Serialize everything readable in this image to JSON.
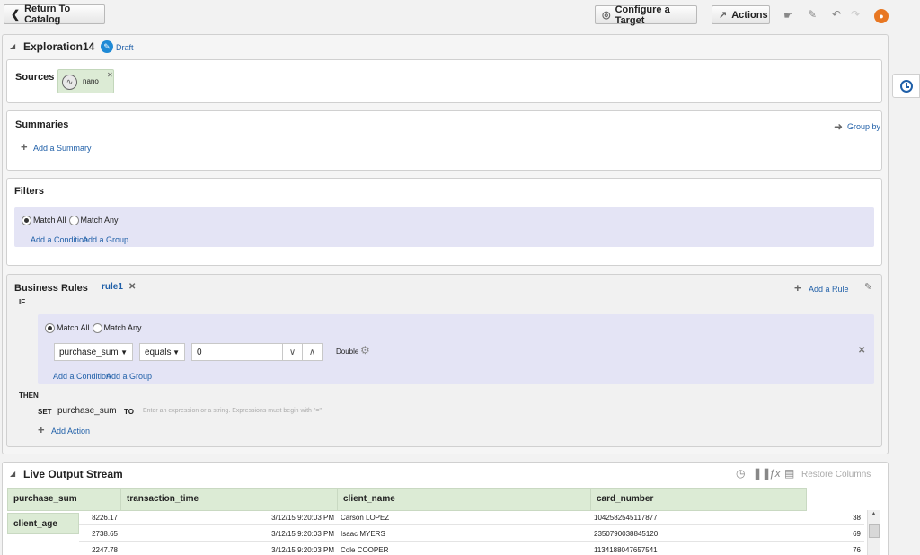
{
  "toolbar": {
    "return_label": "Return To Catalog",
    "configure_label": "Configure a Target",
    "actions_label": "Actions"
  },
  "exploration": {
    "title": "Exploration14",
    "status": "Draft"
  },
  "sources": {
    "label": "Sources",
    "items": [
      {
        "name": "nano"
      }
    ]
  },
  "summaries": {
    "label": "Summaries",
    "group_by_label": "Group by",
    "add_summary_label": "Add a Summary"
  },
  "filters": {
    "label": "Filters",
    "match_all": "Match All",
    "match_any": "Match Any",
    "add_condition": "Add a Condition",
    "add_group": "Add a Group"
  },
  "business_rules": {
    "label": "Business Rules",
    "rule_name": "rule1",
    "add_rule_label": "Add a Rule",
    "if_label": "IF",
    "then_label": "THEN",
    "match_all": "Match All",
    "match_any": "Match Any",
    "condition": {
      "field": "purchase_sum",
      "operator": "equals",
      "value": "0",
      "type": "Double"
    },
    "add_condition": "Add a Condition",
    "add_group": "Add a Group",
    "set_label": "SET",
    "set_field": "purchase_sum",
    "to_label": "TO",
    "expression_placeholder": "Enter an expression or a string. Expressions must begin with \"=\"",
    "add_action_label": "Add Action"
  },
  "live_output": {
    "title": "Live Output Stream",
    "restore_columns": "Restore Columns",
    "columns": [
      "purchase_sum",
      "transaction_time",
      "client_name",
      "card_number"
    ],
    "extra_column": "client_age",
    "rows": [
      {
        "purchase_sum": "8226.17",
        "transaction_time": "3/12/15 9:20:03 PM",
        "client_name": "Carson LOPEZ",
        "card_number": "1042582545117877",
        "client_age": "38"
      },
      {
        "purchase_sum": "2738.65",
        "transaction_time": "3/12/15 9:20:03 PM",
        "client_name": "Isaac MYERS",
        "card_number": "2350790038845120",
        "client_age": "69"
      },
      {
        "purchase_sum": "2247.78",
        "transaction_time": "3/12/15 9:20:03 PM",
        "client_name": "Cole COOPER",
        "card_number": "1134188047657541",
        "client_age": "76"
      }
    ]
  },
  "colors": {
    "accent": "#1f5fa8",
    "header_green": "#dcebd5",
    "lavender": "#e4e4f5",
    "orange": "#e87722"
  }
}
